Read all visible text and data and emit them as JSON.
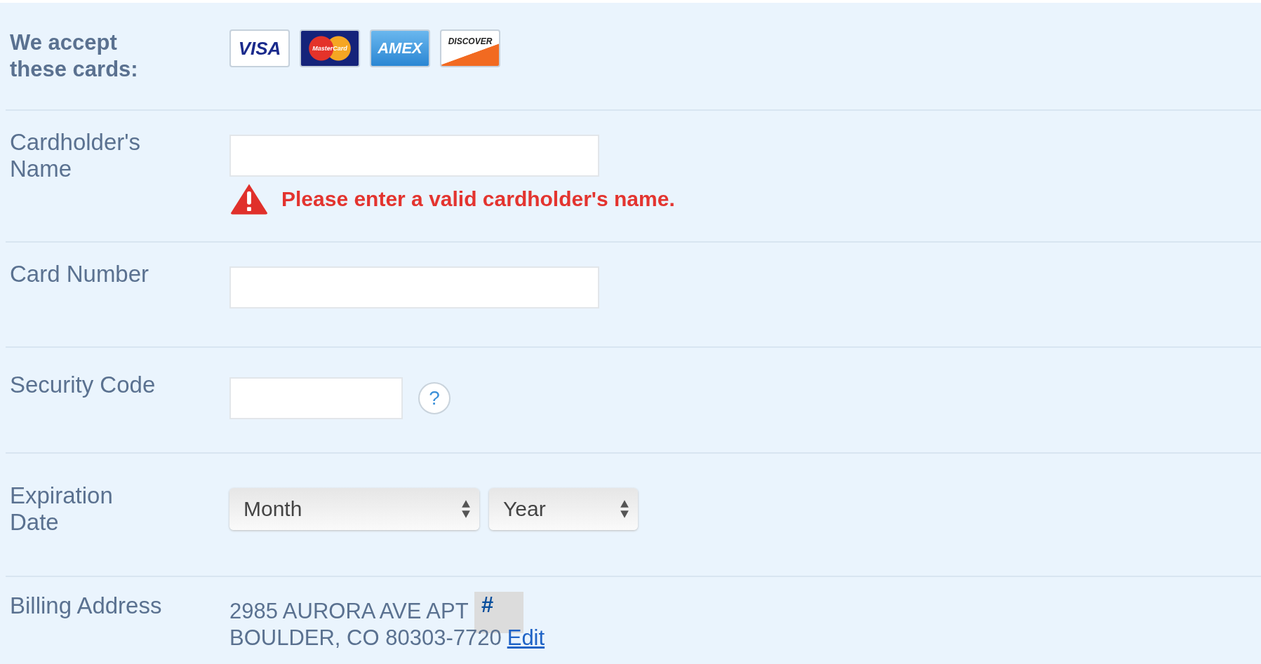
{
  "cards_row": {
    "label": "We accept these cards:",
    "cards": [
      {
        "kind": "visa",
        "text": "VISA"
      },
      {
        "kind": "mastercard",
        "text": "MasterCard"
      },
      {
        "kind": "amex",
        "text": "AMEX"
      },
      {
        "kind": "discover",
        "text": "DISCOVER"
      }
    ]
  },
  "fields": [
    {
      "kind": "input",
      "label": "Cardholder's Name",
      "error": "Please enter a valid cardholder's name."
    },
    {
      "kind": "input",
      "label": "Card Number"
    },
    {
      "kind": "input",
      "label": "Security Code",
      "help": "?"
    },
    {
      "kind": "selects",
      "label": "Expiration Date",
      "selects": [
        "Month",
        "Year"
      ]
    },
    {
      "kind": "address",
      "label": "Billing Address",
      "line1": "2985 AURORA AVE APT",
      "apt": "#",
      "line2": "BOULDER, CO 80303-7720",
      "link": "Edit"
    }
  ]
}
